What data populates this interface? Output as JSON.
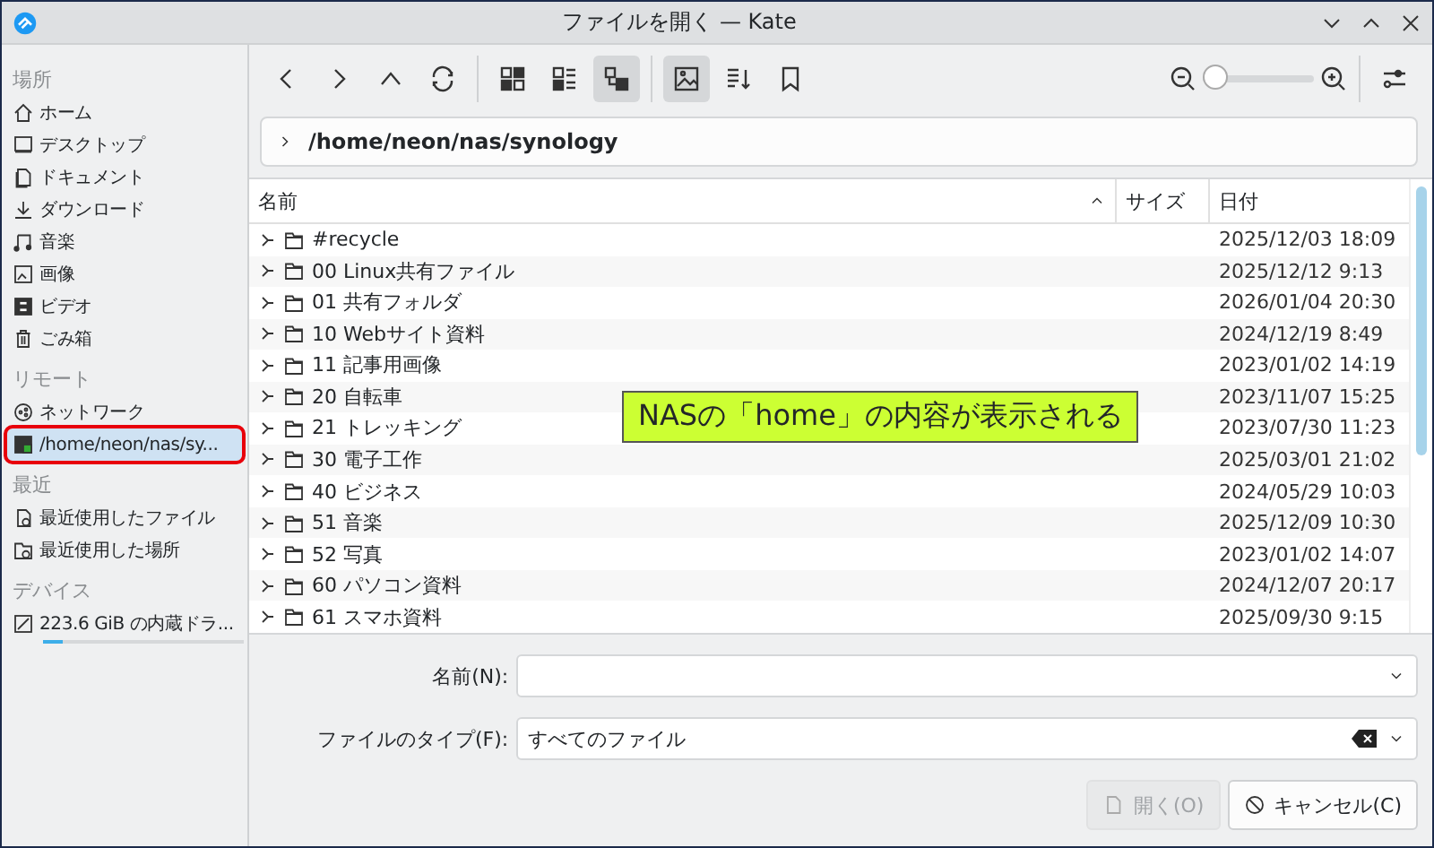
{
  "window": {
    "title": "ファイルを開く — Kate"
  },
  "sidebar": {
    "sections": [
      {
        "heading": "場所",
        "items": [
          {
            "label": "ホーム",
            "selected": false
          },
          {
            "label": "デスクトップ",
            "selected": false
          },
          {
            "label": "ドキュメント",
            "selected": false
          },
          {
            "label": "ダウンロード",
            "selected": false
          },
          {
            "label": "音楽",
            "selected": false
          },
          {
            "label": "画像",
            "selected": false
          },
          {
            "label": "ビデオ",
            "selected": false
          },
          {
            "label": "ごみ箱",
            "selected": false
          }
        ]
      },
      {
        "heading": "リモート",
        "items": [
          {
            "label": "ネットワーク",
            "selected": false
          },
          {
            "label": "/home/neon/nas/sy...",
            "selected": true,
            "highlighted": true
          }
        ]
      },
      {
        "heading": "最近",
        "items": [
          {
            "label": "最近使用したファイル",
            "selected": false
          },
          {
            "label": "最近使用した場所",
            "selected": false
          }
        ]
      },
      {
        "heading": "デバイス",
        "items": [
          {
            "label": "223.6 GiB の内蔵ドラ...",
            "selected": false,
            "level": 0.1
          }
        ]
      }
    ]
  },
  "toolbar": {
    "view_buttons": [
      {
        "selected": false
      },
      {
        "selected": false
      },
      {
        "selected": true
      }
    ],
    "preview": {
      "selected": true
    },
    "zoom": {
      "level": 0
    }
  },
  "path": "/home/neon/nas/synology",
  "table": {
    "columns": [
      "名前",
      "サイズ",
      "日付"
    ],
    "rows": [
      {
        "name": "#recycle",
        "date": "2025/12/03 18:09"
      },
      {
        "name": "00 Linux共有ファイル",
        "date": "2025/12/12 9:13"
      },
      {
        "name": "01 共有フォルダ",
        "date": "2026/01/04 20:30"
      },
      {
        "name": "10 Webサイト資料",
        "date": "2024/12/19 8:49"
      },
      {
        "name": "11 記事用画像",
        "date": "2023/01/02 14:19"
      },
      {
        "name": "20 自転車",
        "date": "2023/11/07 15:25"
      },
      {
        "name": "21 トレッキング",
        "date": "2023/07/30 11:23"
      },
      {
        "name": "30 電子工作",
        "date": "2025/03/01 21:02"
      },
      {
        "name": "40 ビジネス",
        "date": "2024/05/29 10:03"
      },
      {
        "name": "51 音楽",
        "date": "2025/12/09 10:30"
      },
      {
        "name": "52 写真",
        "date": "2023/01/02 14:07"
      },
      {
        "name": "60 パソコン資料",
        "date": "2024/12/07 20:17"
      },
      {
        "name": "61 スマホ資料",
        "date": "2025/09/30 9:15"
      }
    ]
  },
  "annotation": {
    "text": "NASの「home」の内容が表示される"
  },
  "form": {
    "name_label": "名前(N):",
    "type_label": "ファイルのタイプ(F):",
    "type_value": "すべてのファイル"
  },
  "buttons": [
    {
      "label": "開く(O)",
      "disabled": true
    },
    {
      "label": "キャンセル(C)",
      "disabled": false
    }
  ]
}
